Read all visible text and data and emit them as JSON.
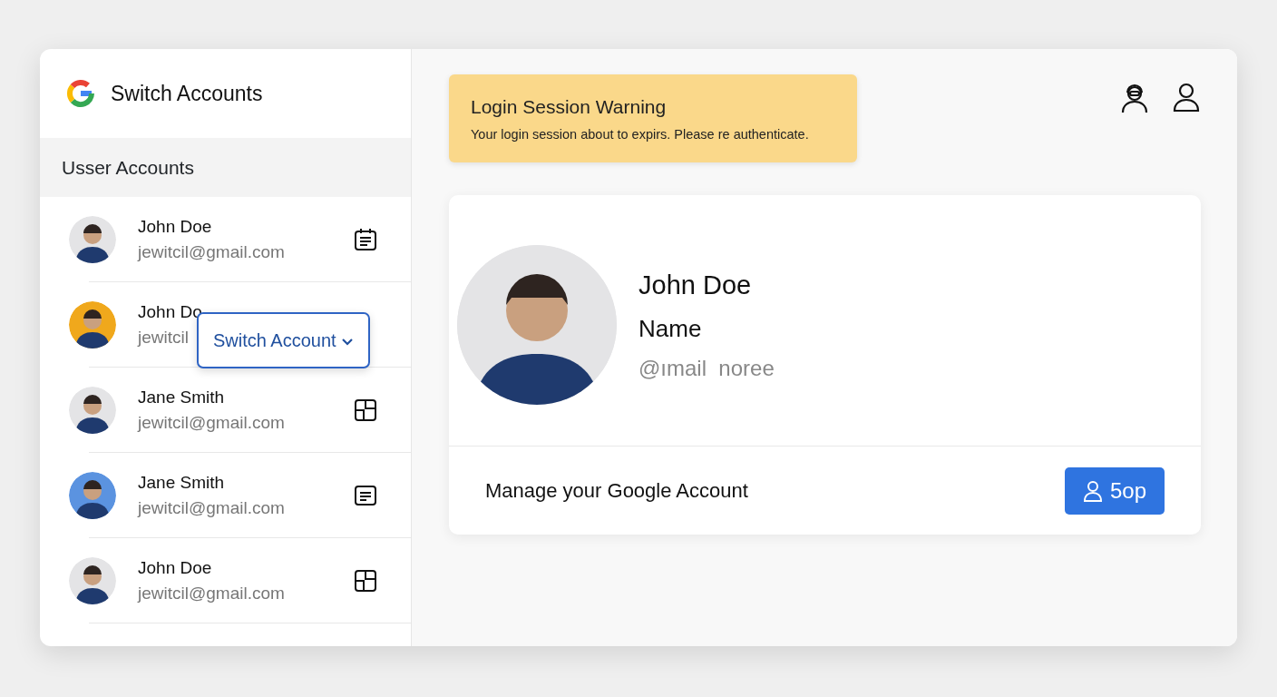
{
  "app": {
    "title": "Switch Accounts"
  },
  "sidebar": {
    "heading": "Usser Accounts",
    "accounts": [
      {
        "name": "John Doe",
        "email": "jewitcil@gmail.com",
        "color": "#e4e4e6",
        "kind": "calendar"
      },
      {
        "name": "John Do",
        "email": "jewitcil",
        "color": "#f0a81c",
        "kind": "hidden"
      },
      {
        "name": "Jane Smith",
        "email": "jewitcil@gmail.com",
        "color": "#e4e4e6",
        "kind": "layout"
      },
      {
        "name": "Jane Smith",
        "email": "jewitcil@gmail.com",
        "color": "#5b93e0",
        "kind": "note"
      },
      {
        "name": "John Doe",
        "email": "jewitcil@gmail.com",
        "color": "#e4e4e6",
        "kind": "layout"
      }
    ],
    "popup": {
      "label": "Switch Account"
    }
  },
  "warning": {
    "title": "Login Session Warning",
    "message": "Your login session about to expirs. Please re authenticate."
  },
  "profile": {
    "name": "John Doe",
    "label": "Name",
    "handle": "@ımail  noree",
    "manage": "Manage your Google Account",
    "button": "5op"
  }
}
